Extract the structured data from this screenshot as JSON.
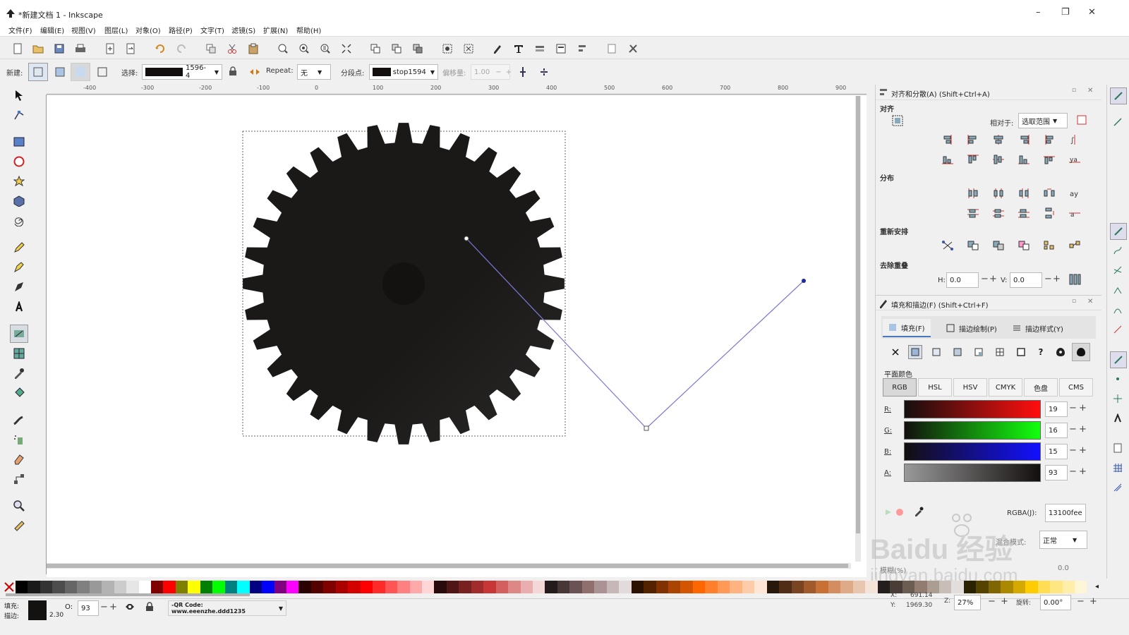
{
  "window": {
    "title": "*新建文档 1 - Inkscape",
    "minimize": "–",
    "maximize": "❐",
    "close": "✕"
  },
  "menu": [
    "文件(F)",
    "编辑(E)",
    "视图(V)",
    "图层(L)",
    "对象(O)",
    "路径(P)",
    "文字(T)",
    "滤镜(S)",
    "扩展(N)",
    "帮助(H)"
  ],
  "toolctl": {
    "new_label": "新建:",
    "select_label": "选择:",
    "gradient_name": "1596-4",
    "repeat_label": "Repeat:",
    "repeat_value": "无",
    "stops_label": "分段点:",
    "stop_name": "stop1594",
    "offset_label": "偏移量:",
    "offset_value": "1.00"
  },
  "ruler_labels": [
    "-400",
    "-300",
    "-200",
    "-100",
    "0",
    "100",
    "200",
    "300",
    "400",
    "500",
    "600",
    "700",
    "800",
    "900"
  ],
  "align_panel": {
    "title": "对齐和分散(A) (Shift+Ctrl+A)",
    "align_section": "对齐",
    "relative_label": "相对于:",
    "relative_value": "选取范围",
    "distribute_section": "分布",
    "rearrange_section": "重新安排",
    "remove_overlap_section": "去除重叠",
    "h_label": "H:",
    "h_value": "0.0",
    "v_label": "V:",
    "v_value": "0.0"
  },
  "fill_panel": {
    "title": "填充和描边(F) (Shift+Ctrl+F)",
    "tabs": [
      "填充(F)",
      "描边绘制(P)",
      "描边样式(Y)"
    ],
    "flat_color_label": "平面颜色",
    "color_modes": [
      "RGB",
      "HSL",
      "HSV",
      "CMYK",
      "色盘",
      "CMS"
    ],
    "channels": [
      {
        "label": "R:",
        "value": "19"
      },
      {
        "label": "G:",
        "value": "16"
      },
      {
        "label": "B:",
        "value": "15"
      },
      {
        "label": "A:",
        "value": "93"
      }
    ],
    "rgba_label": "RGBA(J):",
    "rgba_value": "13100fee",
    "blend_label": "混合模式:",
    "blend_value": "正常",
    "blur_label": "模糊(%)",
    "blur_value": "0.0"
  },
  "status": {
    "fill_label": "填充:",
    "stroke_label": "描边:",
    "stroke_width": "2.30",
    "opacity_label": "O:",
    "opacity_value": "93",
    "layer_label": "-QR Code: www.eeenzhe.ddd1235",
    "x_label": "X:",
    "x_value": "691.14",
    "y_label": "Y:",
    "y_value": "1969.30",
    "zoom_label": "Z:",
    "zoom_value": "27%",
    "rotate_label": "旋转:",
    "rotate_value": "0.00°"
  },
  "watermark": {
    "line1": "Baidu 经验",
    "line2": "jingyan.baidu.com"
  },
  "palette": [
    "#000000",
    "#1a1a1a",
    "#333333",
    "#4d4d4d",
    "#666666",
    "#808080",
    "#999999",
    "#b3b3b3",
    "#cccccc",
    "#e6e6e6",
    "#ffffff",
    "#800000",
    "#ff0000",
    "#808000",
    "#ffff00",
    "#008000",
    "#00ff00",
    "#008080",
    "#00ffff",
    "#000080",
    "#0000ff",
    "#800080",
    "#ff00ff",
    "#2b0000",
    "#550000",
    "#800000",
    "#aa0000",
    "#d40000",
    "#ff0000",
    "#ff2a2a",
    "#ff5555",
    "#ff8080",
    "#ffaaaa",
    "#ffd5d5",
    "#280b0b",
    "#501616",
    "#782121",
    "#a02c2c",
    "#c83737",
    "#d35f5f",
    "#de8787",
    "#e9afaf",
    "#f4d7d7",
    "#241c1c",
    "#483737",
    "#6c5353",
    "#916f6f",
    "#ac9393",
    "#c8b7b7",
    "#e3dbdb",
    "#2b1100",
    "#552200",
    "#803300",
    "#aa4400",
    "#d45500",
    "#ff6600",
    "#ff7f2a",
    "#ff9955",
    "#ffb380",
    "#ffccaa",
    "#ffe6d5",
    "#28170b",
    "#502d16",
    "#784421",
    "#a05a2c",
    "#c87137",
    "#d38d5f",
    "#deaa87",
    "#e9c6af",
    "#f4e3d7",
    "#241f1c",
    "#483e37",
    "#6c5d53",
    "#917c6f",
    "#ac9d93",
    "#c8beb7",
    "#e3dedb",
    "#2b2200",
    "#554400",
    "#806600",
    "#aa8800",
    "#d4aa00",
    "#ffcc00",
    "#ffdd55",
    "#ffe680",
    "#ffeeaa",
    "#fff6d5"
  ]
}
